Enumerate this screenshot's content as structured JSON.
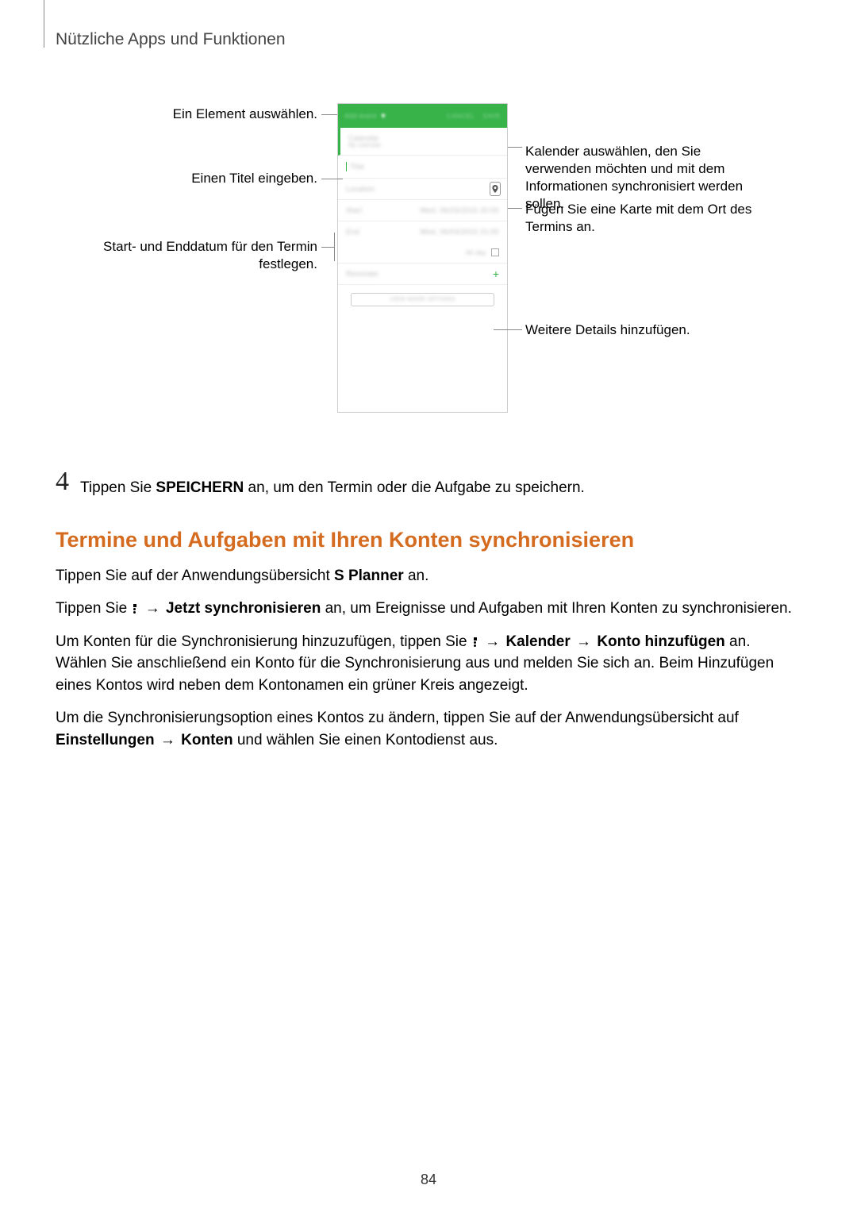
{
  "header": {
    "title": "Nützliche Apps und Funktionen"
  },
  "callouts": {
    "select_element": "Ein Element auswählen.",
    "enter_title": "Einen Titel eingeben.",
    "start_end_line1": "Start- und Enddatum für den Termin",
    "start_end_line2": "festlegen.",
    "calendar_select_l1": "Kalender auswählen, den Sie",
    "calendar_select_l2": "verwenden möchten und mit dem",
    "calendar_select_l3": "Informationen synchronisiert werden",
    "calendar_select_l4": "sollen.",
    "add_map_l1": "Fügen Sie eine Karte mit dem Ort des",
    "add_map_l2": "Termins an.",
    "more_details": "Weitere Details hinzufügen."
  },
  "screenshot": {
    "topbar_left": "Add event",
    "topbar_cancel": "CANCEL",
    "topbar_save": "SAVE",
    "calendar_label": "Calendar",
    "calendar_sub": "My calendar",
    "title_placeholder": "Title",
    "location_placeholder": "Location",
    "start_label": "Start",
    "start_value": "Wed, 06/03/2015  20:00",
    "end_label": "End",
    "end_value": "Wed, 06/03/2015  21:00",
    "allday_label": "All day",
    "reminder_label": "Reminder",
    "more_options": "VIEW MORE OPTIONS"
  },
  "step4": {
    "num": "4",
    "text_a": "Tippen Sie ",
    "text_bold": "SPEICHERN",
    "text_b": " an, um den Termin oder die Aufgabe zu speichern."
  },
  "heading": "Termine und Aufgaben mit Ihren Konten synchronisieren",
  "p1": {
    "a": "Tippen Sie auf der Anwendungsübersicht ",
    "app": "S Planner",
    "b": " an."
  },
  "p2": {
    "a": "Tippen Sie ",
    "arrow": " → ",
    "sync_now": "Jetzt synchronisieren",
    "b": " an, um Ereignisse und Aufgaben mit Ihren Konten zu synchronisieren."
  },
  "p3": {
    "a": "Um Konten für die Synchronisierung hinzuzufügen, tippen Sie ",
    "kalender": "Kalender",
    "konto": "Konto hinzufügen",
    "b": " an. Wählen Sie anschließend ein Konto für die Synchronisierung aus und melden Sie sich an. Beim Hinzufügen eines Kontos wird neben dem Kontonamen ein grüner Kreis angezeigt."
  },
  "p4": {
    "a": "Um die Synchronisierungsoption eines Kontos zu ändern, tippen Sie auf der Anwendungsübersicht auf ",
    "einstellungen": "Einstellungen",
    "arrow": " → ",
    "konten": "Konten",
    "b": " und wählen Sie einen Kontodienst aus."
  },
  "page_number": "84"
}
